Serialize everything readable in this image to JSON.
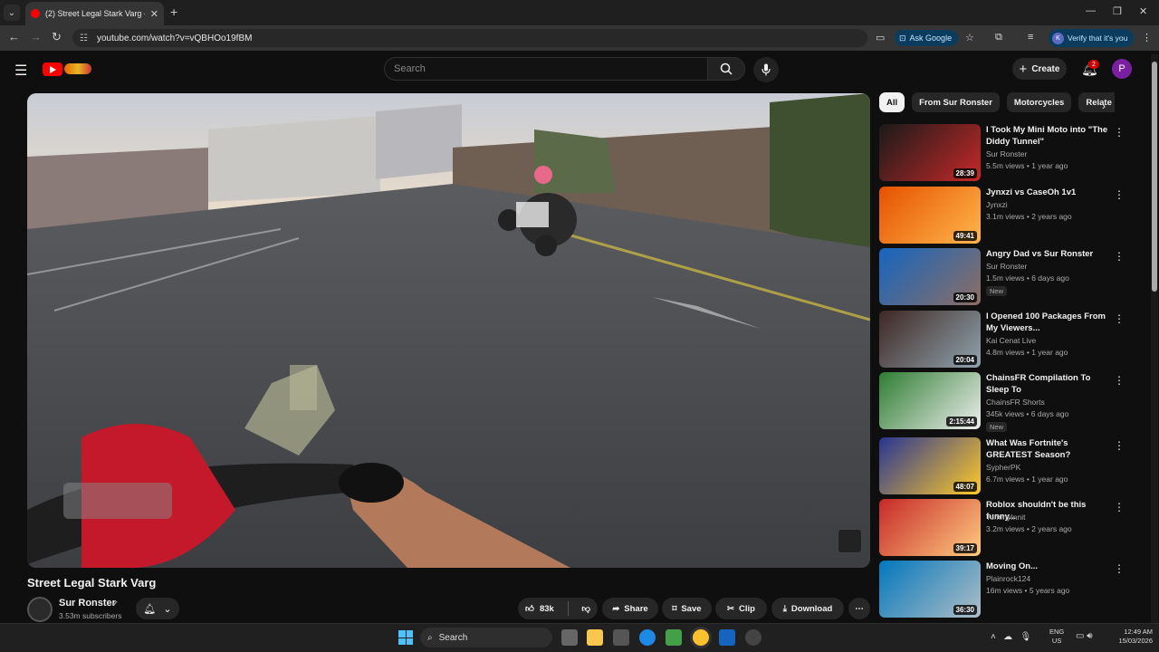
{
  "browser": {
    "tab_title": "(2) Street Legal Stark Varg - You",
    "url": "youtube.com/watch?v=vQBHOo19fBM",
    "ask_google": "Ask Google",
    "verify_label": "Verify that it's you",
    "profile_initial": "K"
  },
  "youtube": {
    "search_placeholder": "Search",
    "create_label": "Create",
    "notification_count": "2",
    "avatar_letter": "P"
  },
  "video": {
    "title": "Street Legal Stark Varg",
    "channel": "Sur Ronster",
    "subscribers": "3.53m subscribers",
    "likes": "83k",
    "share": "Share",
    "save": "Save",
    "clip": "Clip",
    "download": "Download"
  },
  "chips": [
    "All",
    "From Sur Ronster",
    "Motorcycles",
    "Relate"
  ],
  "recommendations": [
    {
      "title": "I Took My Mini Moto into \"The Diddy Tunnel\"",
      "channel": "Sur Ronster",
      "meta": "5.5m views • 1 year ago",
      "duration": "28:39",
      "new": "",
      "lines": 2,
      "colors": [
        "#1a1a1a",
        "#c62828"
      ]
    },
    {
      "title": "Jynxzi vs CaseOh 1v1",
      "channel": "Jynxzi",
      "meta": "3.1m views • 2 years ago",
      "duration": "49:41",
      "new": "",
      "lines": 1,
      "colors": [
        "#e65100",
        "#ffb74d"
      ]
    },
    {
      "title": "Angry Dad vs Sur Ronster",
      "channel": "Sur Ronster",
      "meta": "1.5m views • 6 days ago",
      "duration": "20:30",
      "new": "New",
      "lines": 1,
      "colors": [
        "#1565c0",
        "#8d6e63"
      ]
    },
    {
      "title": "I Opened 100 Packages From My Viewers...",
      "channel": "Kai Cenat Live",
      "meta": "4.8m views • 1 year ago",
      "duration": "20:04",
      "new": "",
      "lines": 2,
      "colors": [
        "#3e2723",
        "#90a4ae"
      ]
    },
    {
      "title": "ChainsFR Compilation To Sleep To",
      "channel": "ChainsFR Shorts",
      "meta": "345k views • 6 days ago",
      "duration": "2:15:44",
      "new": "New",
      "lines": 2,
      "colors": [
        "#2e7d32",
        "#eeeeee"
      ]
    },
    {
      "title": "What Was Fortnite's GREATEST Season?",
      "channel": "SypherPK",
      "meta": "6.7m views • 1 year ago",
      "duration": "48:07",
      "new": "",
      "lines": 2,
      "colors": [
        "#283593",
        "#ffca28"
      ]
    },
    {
      "title": "Roblox shouldn't be this funny...",
      "channel": "TommyInnit",
      "meta": "3.2m views • 2 years ago",
      "duration": "39:17",
      "new": "",
      "lines": 1,
      "colors": [
        "#c62828",
        "#ffcc80"
      ]
    },
    {
      "title": "Moving On...",
      "channel": "Plainrock124",
      "meta": "16m views • 5 years ago",
      "duration": "36:30",
      "new": "",
      "lines": 1,
      "colors": [
        "#0277bd",
        "#b0bec5"
      ]
    }
  ],
  "taskbar": {
    "search": "Search",
    "lang_top": "ENG",
    "lang_bottom": "US",
    "time": "12:49 AM",
    "date": "15/03/2026"
  },
  "colors": {
    "accent": "#ff0000",
    "background": "#0f0f0f",
    "chip_active": "#f1f1f1"
  }
}
